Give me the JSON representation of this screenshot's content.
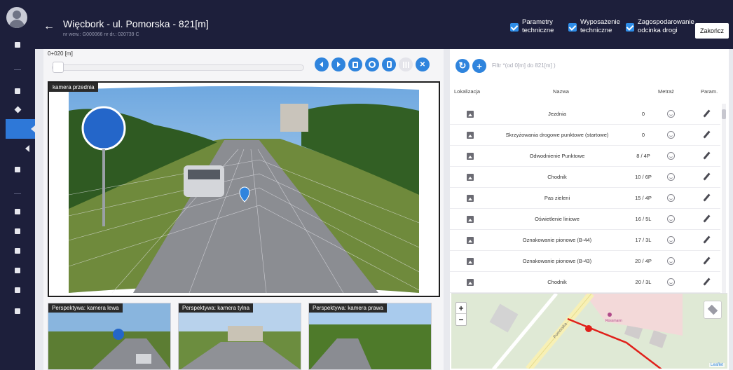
{
  "header": {
    "title": "Więcbork - ul. Pomorska - 821[m]",
    "subtitle": "nr wew.: G000066 nr dr.: 020739 C",
    "checkboxes": [
      {
        "line1": "Parametry",
        "line2": "techniczne",
        "checked": true
      },
      {
        "line1": "Wyposażenie",
        "line2": "techniczne",
        "checked": true
      },
      {
        "line1": "Zagospodarowanie",
        "line2": "odcinka drogi",
        "checked": true
      }
    ],
    "end_button": "Zakończ"
  },
  "viewer": {
    "distance": "0+020 [m]",
    "main_camera_label": "kamera przednia",
    "thumbnails": [
      {
        "label": "Perspektywa: kamera lewa"
      },
      {
        "label": "Perspektywa: kamera tylna"
      },
      {
        "label": "Perspektywa: kamera prawa"
      }
    ],
    "toolbar_icons": [
      "chevron-left-icon",
      "chevron-right-icon",
      "map-icon",
      "target-icon",
      "device-icon",
      "grid-icon",
      "crosshair-off-icon"
    ]
  },
  "table": {
    "filter_placeholder": "Filtr *(od 0[m] do 821[m] )",
    "columns": [
      "Lokalizacja",
      "Nazwa",
      "Metraż",
      "Param."
    ],
    "rows": [
      {
        "name": "Jezdnia",
        "metraz": "0"
      },
      {
        "name": "Skrzyżowania drogowe punktowe (startowe)",
        "metraz": "0"
      },
      {
        "name": "Odwodnienie Punktowe",
        "metraz": "8 / 4P"
      },
      {
        "name": "Chodnik",
        "metraz": "10 / 6P"
      },
      {
        "name": "Pas zieleni",
        "metraz": "15 / 4P"
      },
      {
        "name": "Oświetlenie liniowe",
        "metraz": "16 / 5L"
      },
      {
        "name": "Oznakowanie pionowe (B-44)",
        "metraz": "17 / 3L"
      },
      {
        "name": "Oznakowanie pionowe (B-43)",
        "metraz": "20 / 4P"
      },
      {
        "name": "Chodnik",
        "metraz": "20 / 3L"
      }
    ]
  },
  "map": {
    "zoom_in": "+",
    "zoom_out": "−",
    "street_label": "Pomorska",
    "poi_label": "Rossmann",
    "attribution": "Leaflet"
  },
  "colors": {
    "sidebar": "#1d1f3b",
    "accent": "#2f84dd",
    "route": "#e0201a"
  }
}
